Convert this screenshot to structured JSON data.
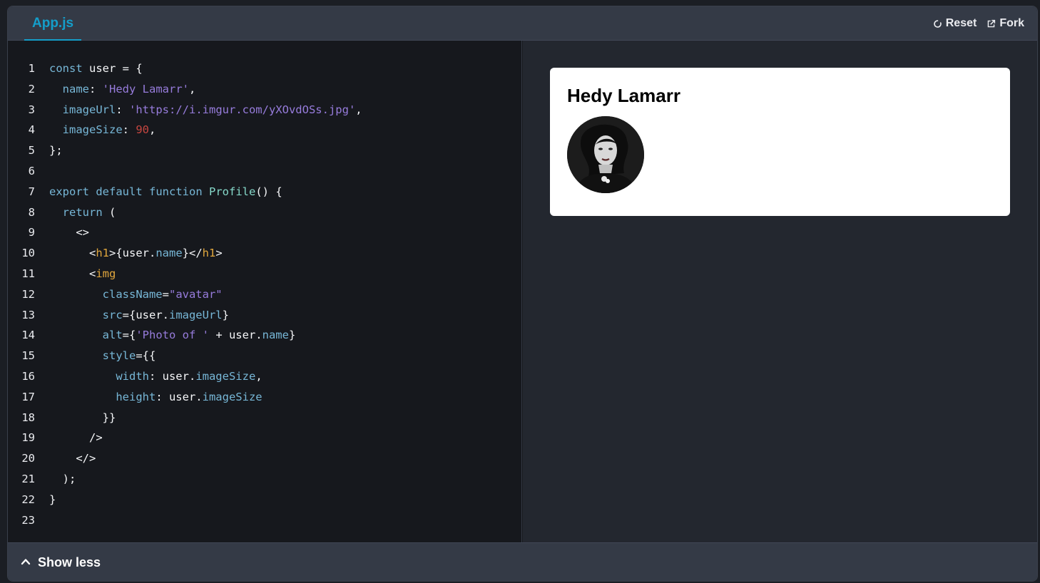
{
  "header": {
    "tab_label": "App.js",
    "reset_label": "Reset",
    "fork_label": "Fork"
  },
  "code": {
    "line_numbers": [
      "1",
      "2",
      "3",
      "4",
      "5",
      "6",
      "7",
      "8",
      "9",
      "10",
      "11",
      "12",
      "13",
      "14",
      "15",
      "16",
      "17",
      "18",
      "19",
      "20",
      "21",
      "22",
      "23"
    ],
    "lines": [
      [
        [
          "kw",
          "const"
        ],
        [
          "pl",
          " user = {"
        ]
      ],
      [
        [
          "prop",
          "  name"
        ],
        [
          "pl",
          ": "
        ],
        [
          "str",
          "'Hedy Lamarr'"
        ],
        [
          "pl",
          ","
        ]
      ],
      [
        [
          "prop",
          "  imageUrl"
        ],
        [
          "pl",
          ": "
        ],
        [
          "str",
          "'https://i.imgur.com/yXOvdOSs.jpg'"
        ],
        [
          "pl",
          ","
        ]
      ],
      [
        [
          "prop",
          "  imageSize"
        ],
        [
          "pl",
          ": "
        ],
        [
          "num",
          "90"
        ],
        [
          "pl",
          ","
        ]
      ],
      [
        [
          "pl",
          "};"
        ]
      ],
      [],
      [
        [
          "kw",
          "export"
        ],
        [
          "pl",
          " "
        ],
        [
          "kw",
          "default"
        ],
        [
          "pl",
          " "
        ],
        [
          "kw",
          "function"
        ],
        [
          "pl",
          " "
        ],
        [
          "fn",
          "Profile"
        ],
        [
          "pl",
          "() {"
        ]
      ],
      [
        [
          "kw",
          "  return"
        ],
        [
          "pl",
          " ("
        ]
      ],
      [
        [
          "pl",
          "    <>"
        ]
      ],
      [
        [
          "pl",
          "      <"
        ],
        [
          "tag",
          "h1"
        ],
        [
          "pl",
          ">{user."
        ],
        [
          "prop",
          "name"
        ],
        [
          "pl",
          "}</"
        ],
        [
          "tag",
          "h1"
        ],
        [
          "pl",
          ">"
        ]
      ],
      [
        [
          "pl",
          "      <"
        ],
        [
          "tag",
          "img"
        ]
      ],
      [
        [
          "attr",
          "        className"
        ],
        [
          "pl",
          "="
        ],
        [
          "str",
          "\"avatar\""
        ]
      ],
      [
        [
          "attr",
          "        src"
        ],
        [
          "pl",
          "={user."
        ],
        [
          "prop",
          "imageUrl"
        ],
        [
          "pl",
          "}"
        ]
      ],
      [
        [
          "attr",
          "        alt"
        ],
        [
          "pl",
          "={"
        ],
        [
          "str",
          "'Photo of '"
        ],
        [
          "pl",
          " + user."
        ],
        [
          "prop",
          "name"
        ],
        [
          "pl",
          "}"
        ]
      ],
      [
        [
          "attr",
          "        style"
        ],
        [
          "pl",
          "={{"
        ]
      ],
      [
        [
          "prop",
          "          width"
        ],
        [
          "pl",
          ": user."
        ],
        [
          "prop",
          "imageSize"
        ],
        [
          "pl",
          ","
        ]
      ],
      [
        [
          "prop",
          "          height"
        ],
        [
          "pl",
          ": user."
        ],
        [
          "prop",
          "imageSize"
        ]
      ],
      [
        [
          "pl",
          "        }}"
        ]
      ],
      [
        [
          "pl",
          "      />"
        ]
      ],
      [
        [
          "pl",
          "    </>"
        ]
      ],
      [
        [
          "pl",
          "  );"
        ]
      ],
      [
        [
          "pl",
          "}"
        ]
      ],
      []
    ]
  },
  "preview": {
    "heading": "Hedy Lamarr",
    "avatar_icon": "portrait-photo"
  },
  "footer": {
    "toggle_label": "Show less"
  },
  "colors": {
    "accent": "#149eca",
    "topbar": "#343a46",
    "editor_bg": "#16181d",
    "preview_bg": "#23272f"
  }
}
